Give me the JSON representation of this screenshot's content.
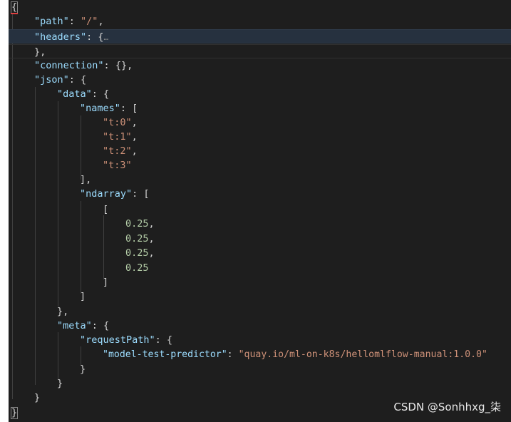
{
  "editor": {
    "code": {
      "open_brace": "{",
      "path_key": "\"path\"",
      "path_value": "\"/\"",
      "headers_key": "\"headers\"",
      "headers_fold": "…",
      "connection_key": "\"connection\"",
      "connection_value": "{}",
      "json_key": "\"json\"",
      "data_key": "\"data\"",
      "names_key": "\"names\"",
      "names": [
        "\"t:0\"",
        "\"t:1\"",
        "\"t:2\"",
        "\"t:3\""
      ],
      "ndarray_key": "\"ndarray\"",
      "ndarray_values": [
        "0.25",
        "0.25",
        "0.25",
        "0.25"
      ],
      "meta_key": "\"meta\"",
      "request_path_key": "\"requestPath\"",
      "model_key": "\"model-test-predictor\"",
      "model_value": "\"quay.io/ml-on-k8s/helloml​flow-manual:1.0.0\"",
      "close_brace": "}"
    }
  },
  "watermark": {
    "text": "CSDN @Sonhhxg_柒"
  },
  "colors": {
    "background": "#1e1e1e",
    "key": "#9cdcfe",
    "string": "#ce9178",
    "number": "#b5cea8",
    "punctuation": "#d4d4d4",
    "highlight_line": "#26313f"
  }
}
